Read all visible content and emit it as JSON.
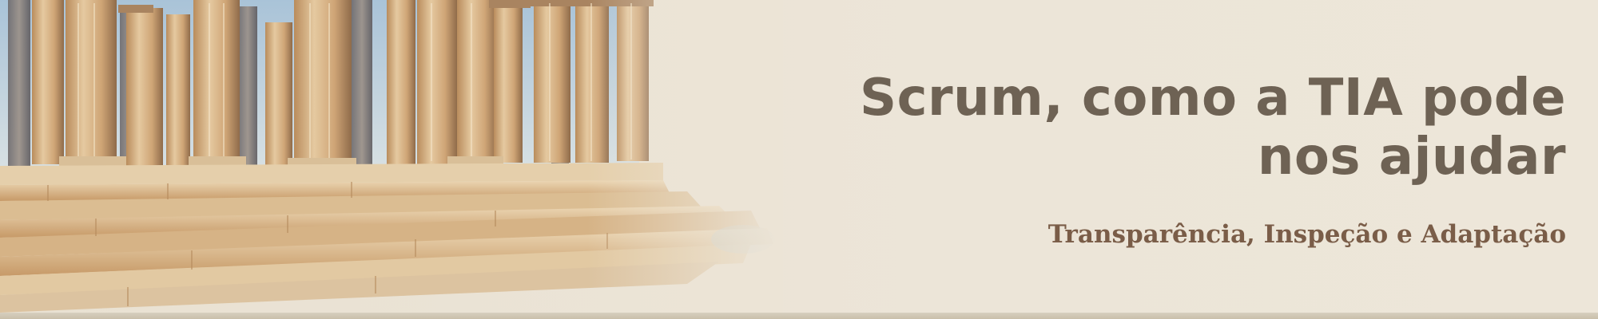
{
  "banner": {
    "title": "Scrum, como a TIA pode nos ajudar",
    "subtitle": "Transparência, Inspeção e Adaptação"
  },
  "colors": {
    "background": "#ece4d6",
    "title": "#6e6254",
    "subtitle": "#7a5d48",
    "stone": "#d9b98c",
    "sky": "#b9cfdf"
  }
}
